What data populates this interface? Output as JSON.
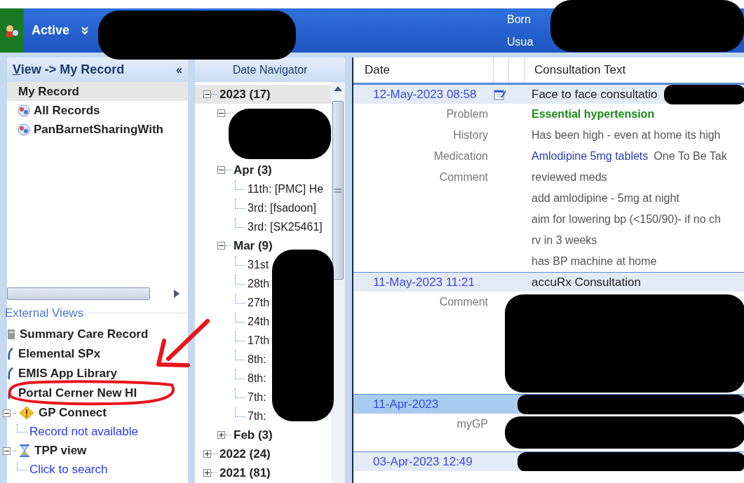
{
  "toolbar": {
    "status": "Active",
    "patient_labels": [
      "Born",
      "Usua"
    ]
  },
  "sidebar": {
    "title": "View -> My Record",
    "collapse_glyph": "«",
    "items": [
      {
        "label": "My Record",
        "kind": "heading",
        "selected": true
      },
      {
        "label": "All Records",
        "kind": "globe",
        "selected": false
      },
      {
        "label": "PanBarnetSharingWith",
        "kind": "globe",
        "selected": false
      }
    ],
    "external_views_title": "External Views",
    "external_views": [
      {
        "label": "Summary Care Record",
        "kind": "scr"
      },
      {
        "label": "Elemental SPx",
        "kind": "app"
      },
      {
        "label": "EMIS App Library",
        "kind": "app"
      },
      {
        "label": "Portal Cerner New HI",
        "kind": "app"
      },
      {
        "label": "GP Connect",
        "kind": "warning",
        "expanded": true,
        "children": [
          {
            "label": "Record not available"
          }
        ]
      },
      {
        "label": "TPP view",
        "kind": "hourglass",
        "expanded": true,
        "children": [
          {
            "label": "Click to search"
          }
        ]
      }
    ]
  },
  "date_navigator": {
    "title": "Date Navigator",
    "tree": [
      {
        "label": "2023 (17)",
        "expanded": true,
        "selected": true,
        "children": [
          {
            "kind": "redacted",
            "expanded": true
          },
          {
            "label": "Apr (3)",
            "expanded": true,
            "selected": false,
            "children": [
              {
                "label": "11th: [PMC] He"
              },
              {
                "label": "3rd: [fsadoon]"
              },
              {
                "label": "3rd: [SK25461]"
              }
            ]
          },
          {
            "label": "Mar (9)",
            "expanded": true,
            "selected": false,
            "children": [
              {
                "label": "31st"
              },
              {
                "label": "28th"
              },
              {
                "label": "27th"
              },
              {
                "label": "24th"
              },
              {
                "label": "17th"
              },
              {
                "label": "8th:"
              },
              {
                "label": "8th:"
              },
              {
                "label": "7th:"
              },
              {
                "label": "7th:"
              }
            ]
          },
          {
            "label": "Feb (3)",
            "expanded": false,
            "selected": false
          }
        ]
      },
      {
        "label": "2022 (24)",
        "expanded": false,
        "selected": false
      },
      {
        "label": "2021 (81)",
        "expanded": false,
        "selected": false
      }
    ]
  },
  "consultations": {
    "columns": [
      "Date",
      "Consultation Text"
    ],
    "entries": [
      {
        "date": "12-May-2023 08:58",
        "title": "Face to face consultatio",
        "selected": false,
        "note_icon": true,
        "redacted_tail": true,
        "details": [
          {
            "label": "Problem",
            "kind": "problem",
            "text": "Essential hypertension"
          },
          {
            "label": "History",
            "kind": "text",
            "lines": [
              "Has been high - even at home its high"
            ]
          },
          {
            "label": "Medication",
            "kind": "medication",
            "link": "Amlodipine 5mg tablets",
            "text": "One To Be Tak"
          },
          {
            "label": "Comment",
            "kind": "text",
            "lines": [
              "reviewed meds",
              "add amlodipine - 5mg at night",
              "aim for lowering bp (<150/90)- if no ch",
              "rv in 3 weeks",
              "has BP machine at home"
            ]
          }
        ]
      },
      {
        "date": "11-May-2023 11:21",
        "title": "accuRx Consultation",
        "selected": false,
        "note_icon": false,
        "details": [
          {
            "label": "Comment",
            "kind": "redacted"
          }
        ]
      },
      {
        "date": "11-Apr-2023",
        "selected": true,
        "note_icon": false,
        "redacted_tail": true,
        "details": [
          {
            "label": "myGP",
            "kind": "redacted_short"
          }
        ]
      },
      {
        "date": "03-Apr-2023 12:49",
        "selected": false,
        "note_icon": false,
        "redacted_tail": true
      }
    ]
  }
}
